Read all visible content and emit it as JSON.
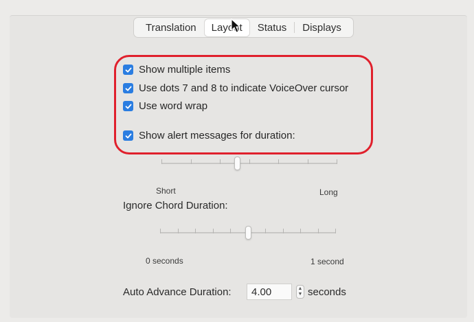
{
  "tabs": [
    {
      "label": "Translation",
      "active": false
    },
    {
      "label": "Layout",
      "active": true
    },
    {
      "label": "Status",
      "active": false
    },
    {
      "label": "Displays",
      "active": false
    }
  ],
  "options": [
    {
      "label": "Show multiple items",
      "checked": true
    },
    {
      "label": "Use dots 7 and 8 to indicate VoiceOver cursor",
      "checked": true
    },
    {
      "label": "Use word wrap",
      "checked": true
    },
    {
      "label": "Show alert messages for duration:",
      "checked": true
    }
  ],
  "alert_duration": {
    "min_label": "Short",
    "max_label": "Long",
    "ticks": 7,
    "value_fraction": 0.43
  },
  "chord_duration": {
    "label": "Ignore Chord Duration:",
    "min_label": "0 seconds",
    "max_label": "1 second",
    "ticks": 11,
    "value_fraction": 0.5
  },
  "auto_advance": {
    "label": "Auto Advance Duration:",
    "value": "4.00",
    "unit": "seconds"
  },
  "colors": {
    "checkbox": "#2a7de1",
    "highlight": "#e0202c"
  }
}
